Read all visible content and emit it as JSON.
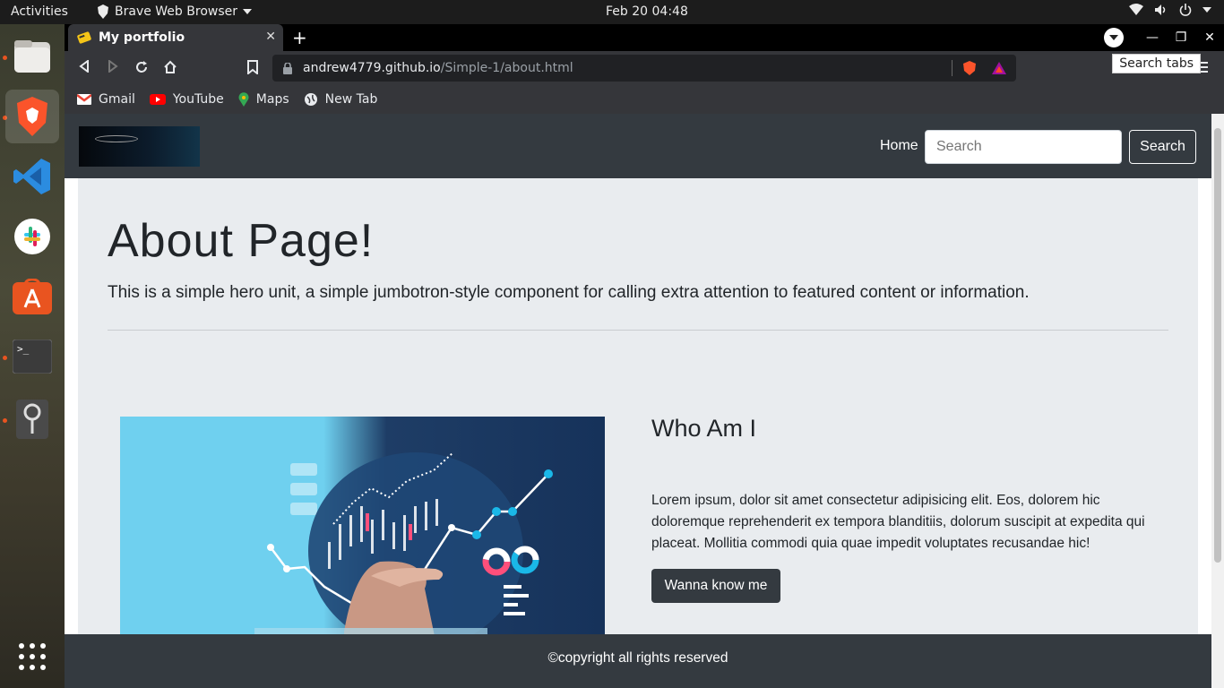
{
  "system": {
    "activities": "Activities",
    "app_menu": "Brave Web Browser",
    "clock": "Feb 20  04:48"
  },
  "dock": {
    "items": [
      "files-icon",
      "brave-icon",
      "vscode-icon",
      "slack-icon",
      "software-icon",
      "terminal-icon",
      "maps-pin-icon",
      "app-grid-icon"
    ]
  },
  "browser": {
    "tab_title": "My portfolio",
    "url_host": "andrew4779.github.io",
    "url_path": "/Simple-1/about.html",
    "tooltip": "Search tabs",
    "bookmarks": [
      "Gmail",
      "YouTube",
      "Maps",
      "New Tab"
    ]
  },
  "page": {
    "nav": {
      "home": "Home",
      "search_placeholder": "Search",
      "search_button": "Search"
    },
    "hero": {
      "title": "About Page!",
      "lead": "This is a simple hero unit, a simple jumbotron-style component for calling extra attention to featured content or information."
    },
    "about": {
      "heading": "Who Am I",
      "paragraph": "Lorem ipsum, dolor sit amet consectetur adipisicing elit. Eos, dolorem hic doloremque reprehenderit ex tempora blanditiis, dolorum suscipit at expedita qui placeat. Mollitia commodi quia quae impedit voluptates recusandae hic!",
      "button": "Wanna know me"
    },
    "footer": "©copyright all rights reserved"
  },
  "colors": {
    "nav_bg": "#343a40",
    "jumbotron_bg": "#e9ecef",
    "brave_orange": "#fb542b"
  }
}
